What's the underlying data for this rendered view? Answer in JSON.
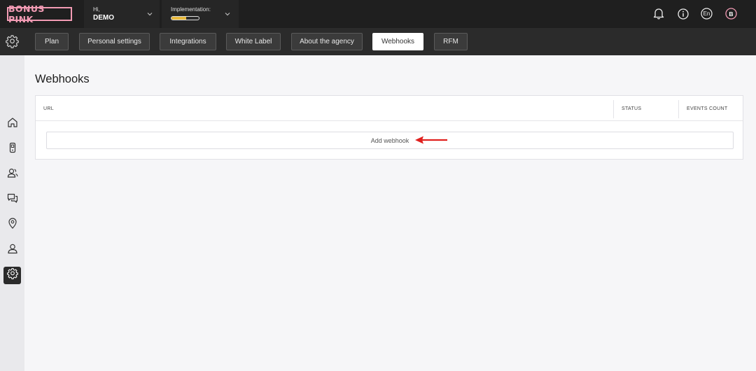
{
  "brand": {
    "logo_text": "BONUS PINK",
    "accent": "#f29bb4"
  },
  "user": {
    "greeting": "Hi,",
    "name": "DEMO"
  },
  "implementation": {
    "label": "Implementation:",
    "progress": 0.55
  },
  "topbar": {
    "language": "En",
    "avatar_letter": "B"
  },
  "tabs": [
    {
      "label": "Plan"
    },
    {
      "label": "Personal settings"
    },
    {
      "label": "Integrations"
    },
    {
      "label": "White Label"
    },
    {
      "label": "About the agency"
    },
    {
      "label": "Webhooks"
    },
    {
      "label": "RFM"
    }
  ],
  "active_tab": "Webhooks",
  "page": {
    "title": "Webhooks"
  },
  "table": {
    "columns": [
      "URL",
      "STATUS",
      "EVENTS COUNT"
    ],
    "add_label": "Add webhook"
  },
  "sidebar": {
    "items": [
      "home-icon",
      "device-icon",
      "users-icon",
      "chat-icon",
      "location-pin-icon",
      "person-icon",
      "settings-icon"
    ],
    "active": "settings-icon"
  },
  "colors": {
    "progress": "#e8b93c",
    "annotation_arrow": "#e0201e",
    "topbar": "#1f1f1f"
  }
}
